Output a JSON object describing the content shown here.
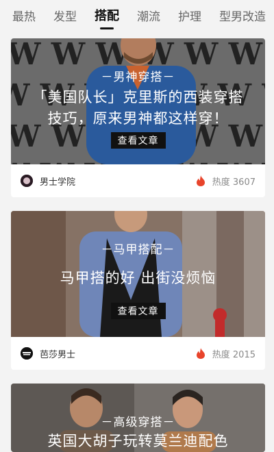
{
  "tabs": [
    "最热",
    "发型",
    "搭配",
    "潮流",
    "护理",
    "型男改造"
  ],
  "active_tab": "搭配",
  "cards": [
    {
      "tagline": "－男神穿搭－",
      "title_line1": "「美国队长」克里斯的西装穿搭",
      "title_line2": "技巧，原来男神都这样穿！",
      "button": "查看文章",
      "author": "男士学院",
      "heat": "热度 3607"
    },
    {
      "tagline": "－马甲搭配－",
      "title_line1": "马甲搭的好 出街没烦恼",
      "button": "查看文章",
      "author": "芭莎男士",
      "heat": "热度 2015"
    },
    {
      "tagline": "－高级穿搭－",
      "title_line1": "英国大胡子玩转莫兰迪配色"
    }
  ],
  "avatar_text": "BAZAAR MEN",
  "colors": {
    "fire": "#e8442b",
    "active_tab": "#111111"
  },
  "icons": {
    "fire": "flame-icon",
    "avatar": "avatar"
  }
}
